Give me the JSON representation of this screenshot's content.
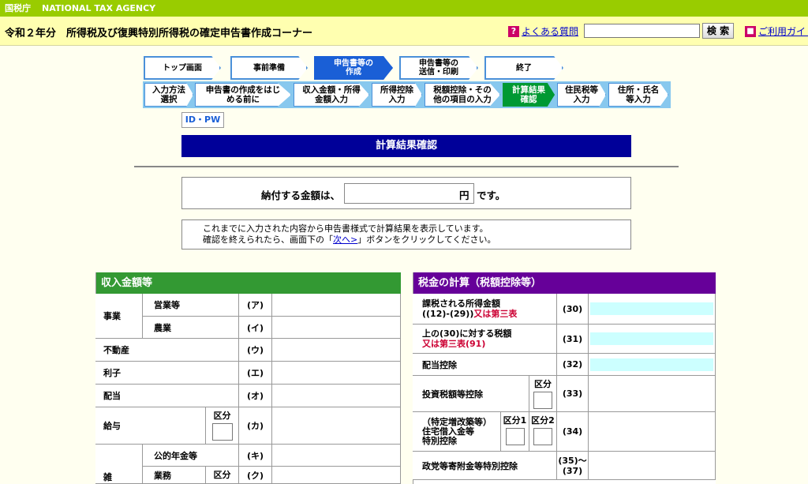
{
  "topbar": {
    "org_ja": "国税庁",
    "org_en": "NATIONAL TAX AGENCY"
  },
  "header": {
    "title": "令和２年分　所得税及び復興特別所得税の確定申告書作成コーナー",
    "faq_label": "よくある質問",
    "search_button": "検 索",
    "search_value": "",
    "guide_label": "ご利用ガイド"
  },
  "steps": [
    {
      "label": "トップ画面"
    },
    {
      "label": "事前準備"
    },
    {
      "label": "申告書等の\n作成"
    },
    {
      "label": "申告書等の\n送信・印刷"
    },
    {
      "label": "終了"
    }
  ],
  "substeps": [
    {
      "label": "入力方法\n選択"
    },
    {
      "label": "申告書の作成をはじ\nめる前に"
    },
    {
      "label": "収入金額・所得\n金額入力"
    },
    {
      "label": "所得控除\n入力"
    },
    {
      "label": "税額控除・その\n他の項目の入力"
    },
    {
      "label": "計算結果\n確認"
    },
    {
      "label": "住民税等\n入力"
    },
    {
      "label": "住所・氏名\n等入力"
    }
  ],
  "idpw_label": "ID・PW",
  "page_title": "計算結果確認",
  "payment": {
    "label": "納付する金額は、",
    "value": "",
    "unit": "円",
    "suffix": "です。"
  },
  "info": {
    "line1": "これまでに入力された内容から申告書様式で計算結果を表示しています。",
    "line2_pre": "確認を終えられたら、画面下の「",
    "line2_link": "次へ>",
    "line2_post": "」ボタンをクリックしてください。"
  },
  "income": {
    "header": "収入金額等",
    "kubun": "区分",
    "rows": {
      "jigyo": "事業",
      "eigyo": "営業等",
      "nogyo": "農業",
      "fudosan": "不動産",
      "rishi": "利子",
      "haito": "配当",
      "kyuyo": "給与",
      "zatsu": "雑",
      "kouteki": "公的年金等",
      "gyomu": "業務"
    },
    "codes": [
      "(ア)",
      "(イ)",
      "(ウ)",
      "(エ)",
      "(オ)",
      "(カ)",
      "(キ)",
      "(ク)"
    ]
  },
  "tax": {
    "header": "税金の計算（税額控除等）",
    "kubun": "区分",
    "kubun1": "区分1",
    "kubun2": "区分2",
    "r30_a": "課税される所得金額",
    "r30_b": "((12)-(29))",
    "r30_c": "又は第三表",
    "r31_a": "上の(30)に対する税額",
    "r31_b": "又は第三表(91)",
    "r32": "配当控除",
    "r33": "投資税額等控除",
    "r34_a": "（特定増改築等）",
    "r34_b": "住宅借入金等",
    "r34_c": "特別控除",
    "r35": "政党等寄附金等特別控除",
    "codes": [
      "(30)",
      "(31)",
      "(32)",
      "(33)",
      "(34)",
      "(35)〜\n(37)"
    ]
  },
  "colors": {
    "income_header": "#339933",
    "tax_header": "#660099",
    "title_bar": "#000099",
    "active_substep": "#009933"
  }
}
